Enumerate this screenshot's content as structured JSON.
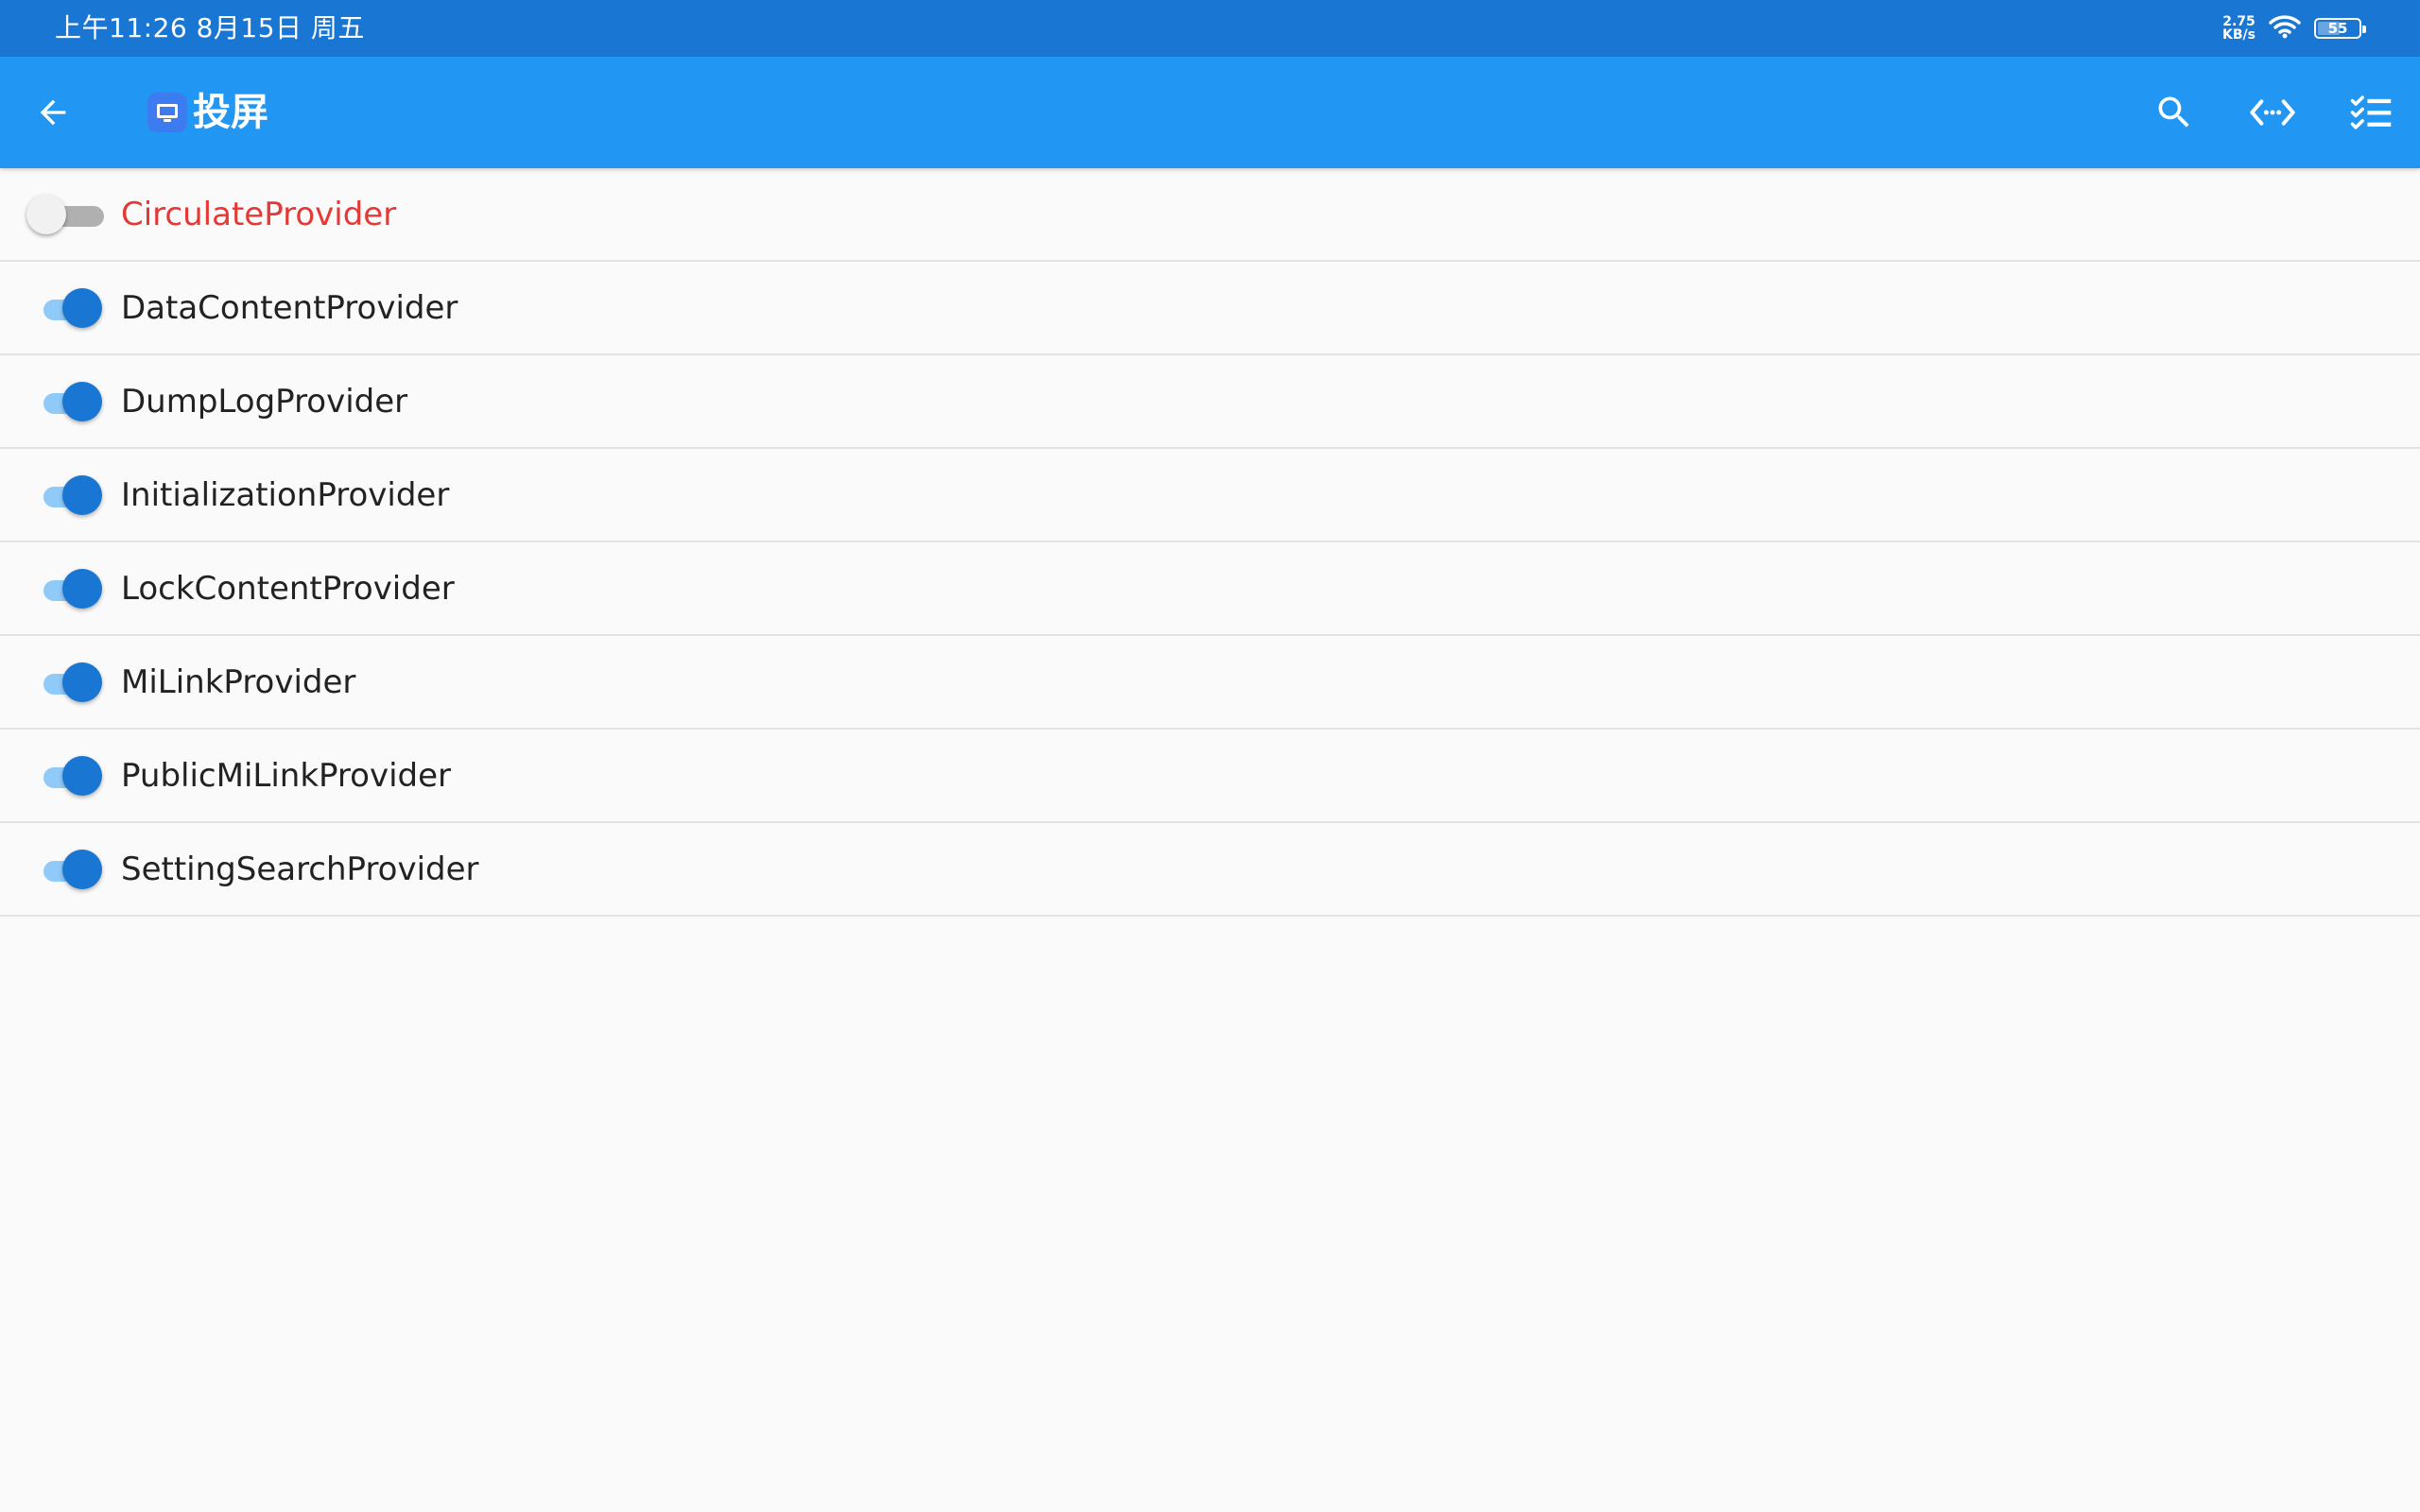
{
  "status_bar": {
    "time": "上午11:26 8月15日 周五",
    "net_speed_value": "2.75",
    "net_speed_unit": "KB/s",
    "battery_level": "55",
    "battery_fraction": 0.55
  },
  "app_bar": {
    "title": "投屏",
    "back_icon": "arrow-back-icon",
    "app_icon": "screen-cast-icon",
    "actions": [
      "search-icon",
      "code-icon",
      "checklist-icon"
    ],
    "background_color": "#2196f3"
  },
  "providers": [
    {
      "name": "CirculateProvider",
      "enabled": false
    },
    {
      "name": "DataContentProvider",
      "enabled": true
    },
    {
      "name": "DumpLogProvider",
      "enabled": true
    },
    {
      "name": "InitializationProvider",
      "enabled": true
    },
    {
      "name": "LockContentProvider",
      "enabled": true
    },
    {
      "name": "MiLinkProvider",
      "enabled": true
    },
    {
      "name": "PublicMiLinkProvider",
      "enabled": true
    },
    {
      "name": "SettingSearchProvider",
      "enabled": true
    }
  ],
  "colors": {
    "status_bar": "#1976d2",
    "switch_on": "#1976d2",
    "disabled_label": "#e53935"
  }
}
